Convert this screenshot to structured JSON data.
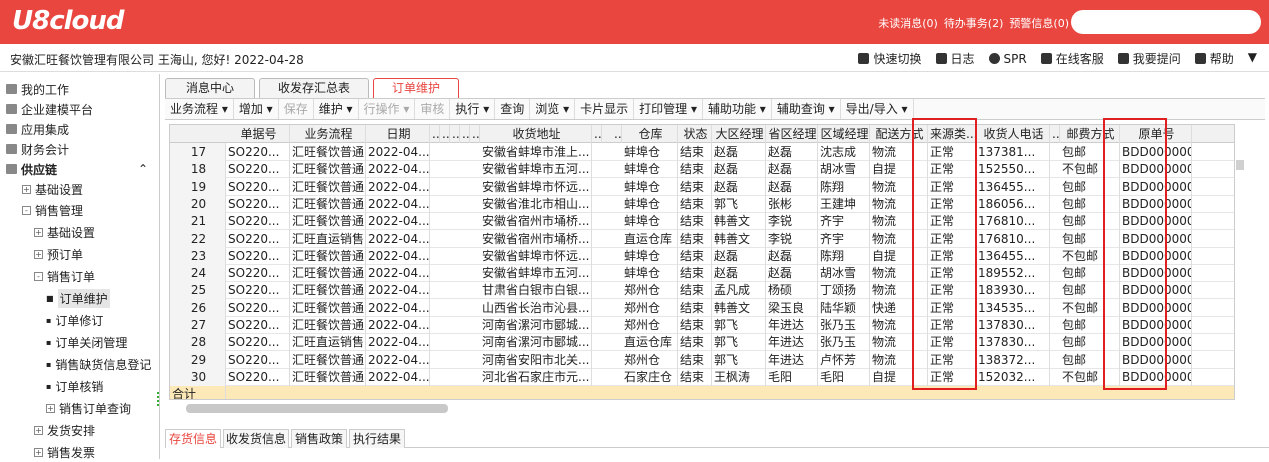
{
  "app": {
    "logo": "U8cloud",
    "top_links": [
      "未读消息(0)",
      "待办事务(2)",
      "预警信息(0)"
    ]
  },
  "info": {
    "company": "安徽汇旺餐饮管理有限公司 王海山, 您好! 2022-04-28",
    "tools": [
      "快速切换",
      "日志",
      "SPR",
      "在线客服",
      "我要提问",
      "帮助"
    ]
  },
  "sidebar": {
    "items": [
      {
        "label": "我的工作",
        "level": 0,
        "icon": "briefcase-icon"
      },
      {
        "label": "企业建模平台",
        "level": 0,
        "icon": "building-icon"
      },
      {
        "label": "应用集成",
        "level": 0,
        "icon": "grid-icon"
      },
      {
        "label": "财务会计",
        "level": 0,
        "icon": "calculator-icon"
      },
      {
        "label": "供应链",
        "level": 0,
        "icon": "truck-icon",
        "bold": true
      },
      {
        "label": "基础设置",
        "level": 1,
        "toggle": "+"
      },
      {
        "label": "销售管理",
        "level": 1,
        "toggle": "-"
      },
      {
        "label": "基础设置",
        "level": 2,
        "toggle": "+"
      },
      {
        "label": "预订单",
        "level": 2,
        "toggle": "+"
      },
      {
        "label": "销售订单",
        "level": 2,
        "toggle": "-"
      },
      {
        "label": "订单维护",
        "level": 3,
        "selected": true
      },
      {
        "label": "订单修订",
        "level": 3
      },
      {
        "label": "订单关闭管理",
        "level": 3
      },
      {
        "label": "销售缺货信息登记",
        "level": 3
      },
      {
        "label": "订单核销",
        "level": 3
      },
      {
        "label": "销售订单查询",
        "level": 3,
        "toggle": "+"
      },
      {
        "label": "发货安排",
        "level": 2,
        "toggle": "+"
      },
      {
        "label": "销售发票",
        "level": 2,
        "toggle": "+"
      }
    ]
  },
  "tabs": [
    "消息中心",
    "收发存汇总表",
    "订单维护"
  ],
  "toolbar": [
    {
      "label": "业务流程",
      "dd": true
    },
    {
      "label": "增加",
      "dd": true
    },
    {
      "label": "保存",
      "disabled": true
    },
    {
      "label": "维护",
      "dd": true
    },
    {
      "label": "行操作",
      "dd": true,
      "disabled": true
    },
    {
      "label": "审核",
      "disabled": true
    },
    {
      "label": "执行",
      "dd": true
    },
    {
      "label": "查询"
    },
    {
      "label": "浏览",
      "dd": true
    },
    {
      "label": "卡片显示"
    },
    {
      "label": "打印管理",
      "dd": true
    },
    {
      "label": "辅助功能",
      "dd": true
    },
    {
      "label": "辅助查询",
      "dd": true
    },
    {
      "label": "导出/导入",
      "dd": true
    }
  ],
  "table": {
    "headers": [
      "单据号",
      "业务流程",
      "日期",
      "...",
      "...",
      "...",
      "...",
      "...",
      "收货地址",
      "...",
      "...",
      "仓库",
      "状态",
      "大区经理",
      "省区经理",
      "区域经理",
      "配送方式",
      "来源类...",
      "收货人电话",
      "...",
      "邮费方式",
      "原单号"
    ],
    "rows": [
      [
        "17",
        "SO220...",
        "汇旺餐饮普通...",
        "2022-04...",
        "安徽省蚌埠市淮上...",
        "蚌埠仓",
        "结束",
        "赵磊",
        "赵磊",
        "沈志成",
        "物流",
        "正常",
        "137381...",
        "包邮",
        "BDD000000."
      ],
      [
        "18",
        "SO220...",
        "汇旺餐饮普通...",
        "2022-04...",
        "安徽省蚌埠市五河...",
        "蚌埠仓",
        "结束",
        "赵磊",
        "赵磊",
        "胡冰雪",
        "自提",
        "正常",
        "152550...",
        "不包邮",
        "BDD000000."
      ],
      [
        "19",
        "SO220...",
        "汇旺餐饮普通...",
        "2022-04...",
        "安徽省蚌埠市怀远...",
        "蚌埠仓",
        "结束",
        "赵磊",
        "赵磊",
        "陈翔",
        "物流",
        "正常",
        "136455...",
        "包邮",
        "BDD000000."
      ],
      [
        "20",
        "SO220...",
        "汇旺餐饮普通...",
        "2022-04...",
        "安徽省淮北市相山...",
        "蚌埠仓",
        "结束",
        "郭飞",
        "张彬",
        "王建坤",
        "物流",
        "正常",
        "186056...",
        "包邮",
        "BDD000000."
      ],
      [
        "21",
        "SO220...",
        "汇旺餐饮普通...",
        "2022-04...",
        "安徽省宿州市埇桥...",
        "蚌埠仓",
        "结束",
        "韩善文",
        "李锐",
        "齐宇",
        "物流",
        "正常",
        "176810...",
        "包邮",
        "BDD000000."
      ],
      [
        "22",
        "SO220...",
        "汇旺直运销售...",
        "2022-04...",
        "安徽省宿州市埇桥...",
        "直运仓库",
        "结束",
        "韩善文",
        "李锐",
        "齐宇",
        "物流",
        "正常",
        "176810...",
        "包邮",
        "BDD000000."
      ],
      [
        "23",
        "SO220...",
        "汇旺餐饮普通...",
        "2022-04...",
        "安徽省蚌埠市怀远...",
        "蚌埠仓",
        "结束",
        "赵磊",
        "赵磊",
        "陈翔",
        "自提",
        "正常",
        "136455...",
        "不包邮",
        "BDD000000."
      ],
      [
        "24",
        "SO220...",
        "汇旺餐饮普通...",
        "2022-04...",
        "安徽省蚌埠市五河...",
        "蚌埠仓",
        "结束",
        "赵磊",
        "赵磊",
        "胡冰雪",
        "物流",
        "正常",
        "189552...",
        "包邮",
        "BDD000000."
      ],
      [
        "25",
        "SO220...",
        "汇旺餐饮普通...",
        "2022-04...",
        "甘肃省白银市白银...",
        "郑州仓",
        "结束",
        "孟凡成",
        "杨硕",
        "丁颂扬",
        "物流",
        "正常",
        "183930...",
        "包邮",
        "BDD000000."
      ],
      [
        "26",
        "SO220...",
        "汇旺餐饮普通...",
        "2022-04...",
        "山西省长治市沁县...",
        "郑州仓",
        "结束",
        "韩善文",
        "梁玉良",
        "陆华颖",
        "快递",
        "正常",
        "134535...",
        "不包邮",
        "BDD000000."
      ],
      [
        "27",
        "SO220...",
        "汇旺餐饮普通...",
        "2022-04...",
        "河南省漯河市郾城...",
        "郑州仓",
        "结束",
        "郭飞",
        "年进达",
        "张乃玉",
        "物流",
        "正常",
        "137830...",
        "包邮",
        "BDD000000."
      ],
      [
        "28",
        "SO220...",
        "汇旺直运销售...",
        "2022-04...",
        "河南省漯河市郾城...",
        "直运仓库",
        "结束",
        "郭飞",
        "年进达",
        "张乃玉",
        "物流",
        "正常",
        "137830...",
        "包邮",
        "BDD000000."
      ],
      [
        "29",
        "SO220...",
        "汇旺餐饮普通...",
        "2022-04...",
        "河南省安阳市北关...",
        "郑州仓",
        "结束",
        "郭飞",
        "年进达",
        "卢怀芳",
        "物流",
        "正常",
        "138372...",
        "包邮",
        "BDD000000."
      ],
      [
        "30",
        "SO220...",
        "汇旺餐饮普通...",
        "2022-04...",
        "河北省石家庄市元...",
        "石家庄仓",
        "结束",
        "王枫涛",
        "毛阳",
        "毛阳",
        "自提",
        "正常",
        "152032...",
        "不包邮",
        "BDD000000."
      ]
    ],
    "total_label": "合计"
  },
  "bottom_tabs": [
    "存货信息",
    "收发货信息",
    "销售政策",
    "执行结果"
  ],
  "colors": {
    "brand": "#e8463f",
    "highlight_box": "#e02020"
  }
}
